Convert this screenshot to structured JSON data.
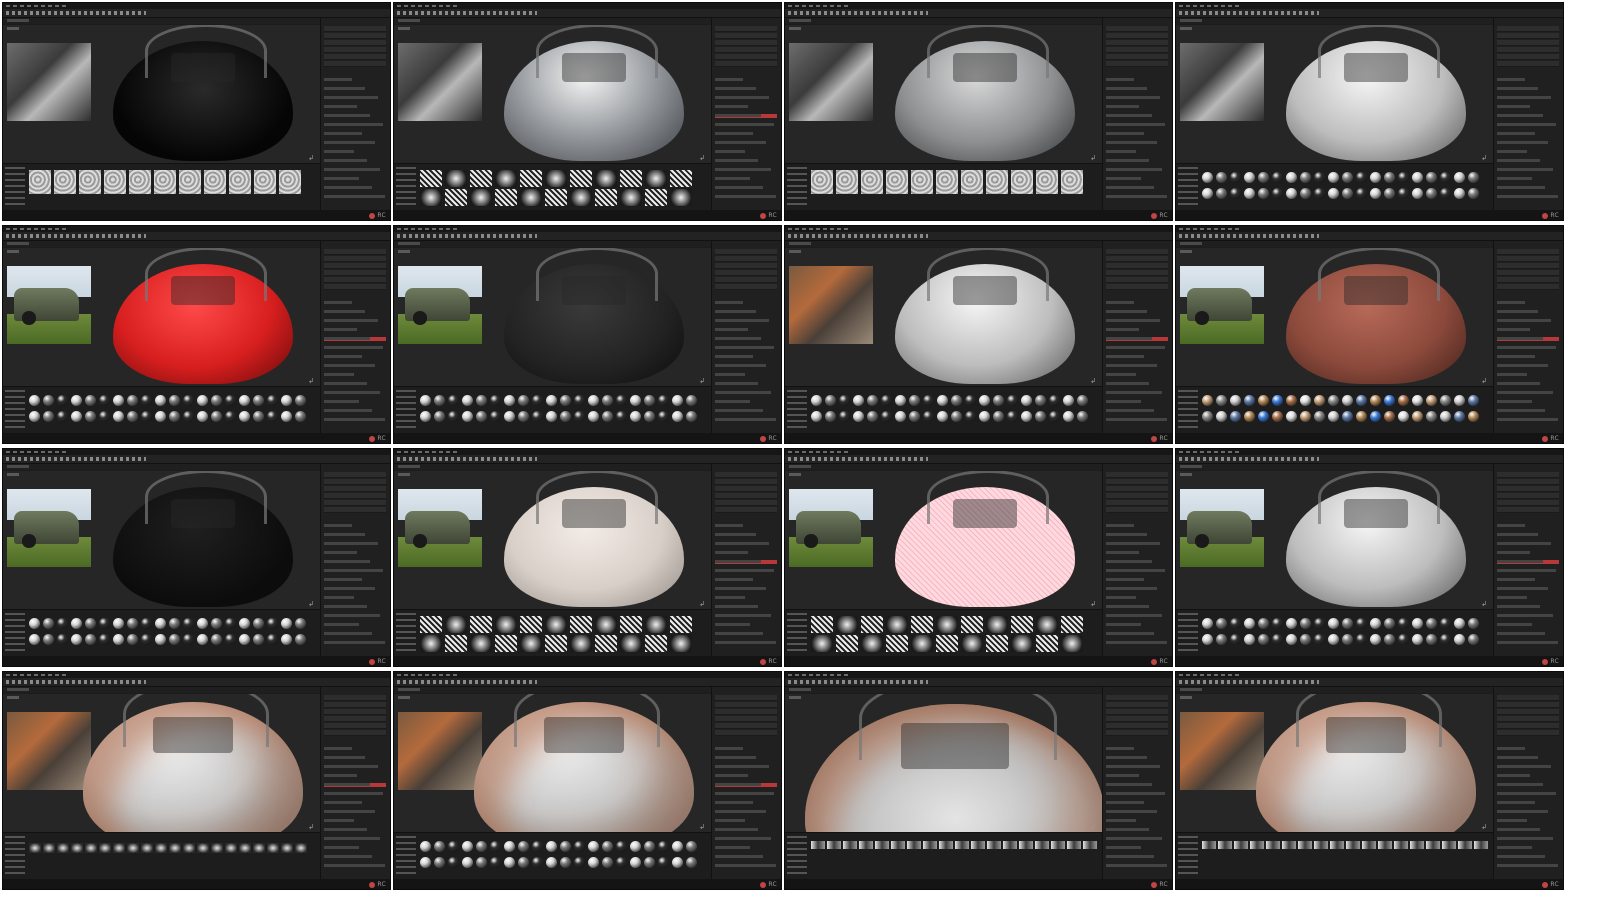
{
  "page": {
    "layout": "4x4 contact sheet of Substance Painter editor screenshots",
    "watermark_text": "RC"
  },
  "colors": {
    "frame_bg": "#ffffff",
    "ui_dark": "#1c1c1c",
    "viewport": "#262626",
    "accent_red": "#b8383a"
  },
  "icons": {
    "axis_gizmo": "↲",
    "watermark": "rc-logo-icon"
  },
  "tiles": [
    {
      "model_style": "black-edges",
      "shelf": "swatches-grey",
      "ref": "robot",
      "accent": false
    },
    {
      "model_style": "chrome",
      "shelf": "swatches-bw",
      "ref": "robot",
      "accent": true
    },
    {
      "model_style": "metal-grey",
      "shelf": "swatches-grey",
      "ref": "robot",
      "accent": false
    },
    {
      "model_style": "white-clean",
      "shelf": "spheres",
      "ref": "robot",
      "accent": false
    },
    {
      "model_style": "red",
      "shelf": "spheres",
      "ref": "truck",
      "accent": true
    },
    {
      "model_style": "dark",
      "shelf": "spheres",
      "ref": "truck",
      "accent": false
    },
    {
      "model_style": "white-clean",
      "shelf": "spheres",
      "ref": "rusty",
      "accent": true
    },
    {
      "model_style": "brown-rust",
      "shelf": "spheres-color",
      "ref": "truck",
      "accent": true
    },
    {
      "model_style": "black",
      "shelf": "spheres",
      "ref": "truck",
      "accent": false
    },
    {
      "model_style": "pale",
      "shelf": "swatches-bw",
      "ref": "truck",
      "accent": true
    },
    {
      "model_style": "pink-wire",
      "shelf": "swatches-bw",
      "ref": "truck",
      "accent": false
    },
    {
      "model_style": "white-clean",
      "shelf": "spheres",
      "ref": "truck",
      "accent": true
    },
    {
      "model_style": "rust-white",
      "shelf": "brushes",
      "ref": "rusty",
      "accent": true
    },
    {
      "model_style": "rust-white",
      "shelf": "spheres",
      "ref": "rusty",
      "accent": true
    },
    {
      "model_style": "rust-close",
      "shelf": "strip",
      "ref": "none",
      "accent": false
    },
    {
      "model_style": "rust-white",
      "shelf": "strip",
      "ref": "rusty",
      "accent": false
    }
  ]
}
